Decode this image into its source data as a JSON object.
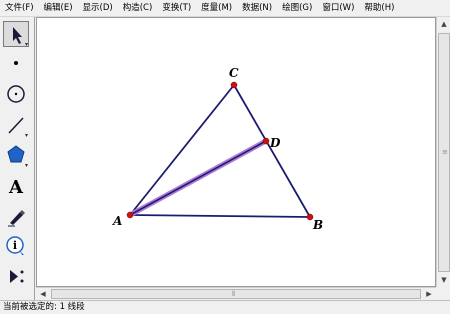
{
  "menu": [
    "文件(F)",
    "编辑(E)",
    "显示(D)",
    "构造(C)",
    "变换(T)",
    "度量(M)",
    "数据(N)",
    "绘图(G)",
    "窗口(W)",
    "帮助(H)"
  ],
  "toolbar": {
    "tools": [
      "arrow-select-tool",
      "point-tool",
      "compass-tool",
      "straightedge-tool",
      "polygon-tool",
      "text-tool",
      "marker-tool",
      "information-tool",
      "custom-tool"
    ],
    "active_tool": "arrow-select-tool",
    "text_tool_glyph": "A"
  },
  "figure": {
    "labels": {
      "A": "A",
      "B": "B",
      "C": "C",
      "D": "D"
    },
    "segment_color": "#1c1c6e",
    "selected_segment_color": "#b07ad8",
    "point_color": "#d01010"
  },
  "status": {
    "text": "当前被选定的: 1 线段"
  }
}
